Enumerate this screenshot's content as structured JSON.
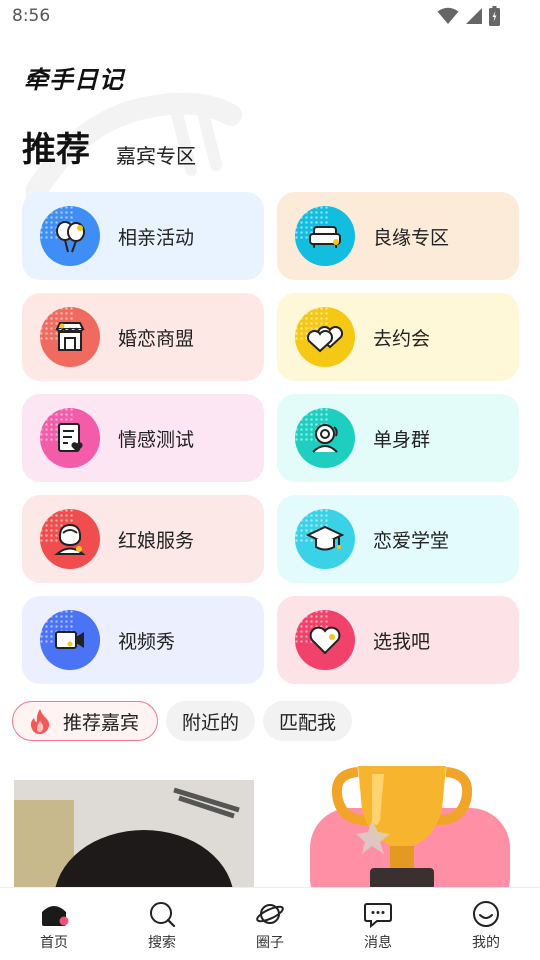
{
  "status_bar": {
    "time": "8:56"
  },
  "app": {
    "logo_text": "牵手日记"
  },
  "heading": {
    "main": "推荐",
    "sub": "嘉宾专区"
  },
  "categories": [
    {
      "label": "相亲活动",
      "icon": "balloons-icon",
      "bg": "#e8f3ff",
      "icon_color": "#3f8ef5"
    },
    {
      "label": "良缘专区",
      "icon": "sofa-icon",
      "bg": "#fdebd9",
      "icon_color": "#13bde0"
    },
    {
      "label": "婚恋商盟",
      "icon": "shop-icon",
      "bg": "#fde8e6",
      "icon_color": "#f06b5f"
    },
    {
      "label": "去约会",
      "icon": "hearts-icon",
      "bg": "#fff8d8",
      "icon_color": "#f5c816"
    },
    {
      "label": "情感测试",
      "icon": "test-paper-icon",
      "bg": "#fde6f3",
      "icon_color": "#f25ca8"
    },
    {
      "label": "单身群",
      "icon": "single-person-icon",
      "bg": "#e3fbf9",
      "icon_color": "#1ecfc1"
    },
    {
      "label": "红娘服务",
      "icon": "matchmaker-icon",
      "bg": "#fde8e8",
      "icon_color": "#f04e4e"
    },
    {
      "label": "恋爱学堂",
      "icon": "graduation-cap-icon",
      "bg": "#e3fbfd",
      "icon_color": "#3bd2e8"
    },
    {
      "label": "视频秀",
      "icon": "video-camera-icon",
      "bg": "#eceffd",
      "icon_color": "#4b73f5"
    },
    {
      "label": "选我吧",
      "icon": "heart-icon",
      "bg": "#fde2e7",
      "icon_color": "#f1426b"
    }
  ],
  "tabs": [
    {
      "label": "推荐嘉宾",
      "active": true
    },
    {
      "label": "附近的",
      "active": false
    },
    {
      "label": "匹配我",
      "active": false
    }
  ],
  "bottom_nav": [
    {
      "label": "首页",
      "icon": "home-icon",
      "active": true
    },
    {
      "label": "搜索",
      "icon": "search-icon",
      "active": false
    },
    {
      "label": "圈子",
      "icon": "planet-icon",
      "active": false
    },
    {
      "label": "消息",
      "icon": "message-icon",
      "active": false
    },
    {
      "label": "我的",
      "icon": "profile-icon",
      "active": false
    }
  ],
  "colors": {
    "accent": "#f07788",
    "text": "#222222"
  }
}
